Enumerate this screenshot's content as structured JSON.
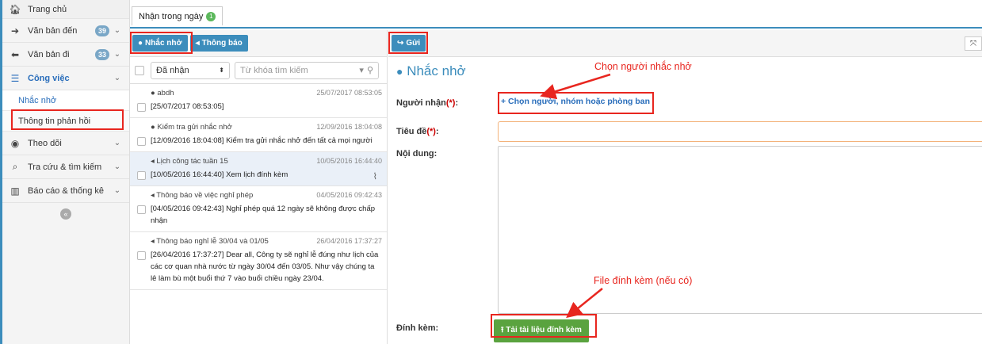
{
  "sidebar": {
    "home": "Trang chủ",
    "items": [
      {
        "label": "Văn bản đến",
        "badge": "39"
      },
      {
        "label": "Văn bản đi",
        "badge": "33"
      },
      {
        "label": "Công việc"
      }
    ],
    "sub_items": [
      "Nhắc nhở",
      "Thông tin phản hồi"
    ],
    "items2": [
      {
        "label": "Theo dõi"
      },
      {
        "label": "Tra cứu & tìm kiếm"
      },
      {
        "label": "Báo cáo & thống kê"
      }
    ]
  },
  "tab": {
    "label": "Nhận trong ngày",
    "count": "1"
  },
  "list_toolbar": {
    "reminder_button": "Nhắc nhở",
    "notice_button": "Thông báo"
  },
  "filter": {
    "selected": "Đã nhận",
    "search_placeholder": "Từ khóa tìm kiếm"
  },
  "messages": [
    {
      "title": "abdh",
      "date": "25/07/2017 08:53:05",
      "body": "[25/07/2017 08:53:05]"
    },
    {
      "title": "Kiểm tra gửi nhắc nhở",
      "date": "12/09/2016 18:04:08",
      "body": "[12/09/2016 18:04:08] Kiểm tra gửi nhắc nhở đến tất cả mọi người"
    },
    {
      "title": "Lịch công tác tuần 15",
      "date": "10/05/2016 16:44:40",
      "body": "[10/05/2016 16:44:40] Xem lịch đính kèm"
    },
    {
      "title": "Thông báo về việc nghỉ phép",
      "date": "04/05/2016 09:42:43",
      "body": "[04/05/2016 09:42:43] Nghỉ phép quá 12 ngày sẽ không được chấp nhận"
    },
    {
      "title": "Thông báo nghỉ lễ 30/04 và 01/05",
      "date": "26/04/2016 17:37:27",
      "body": "[26/04/2016 17:37:27] Dear all, Công ty sẽ nghỉ lễ đúng như lịch của các cơ quan nhà nước từ ngày 30/04 đến 03/05. Như vậy chúng ta lê làm bù một buổi thứ 7 vào buổi chiều ngày 23/04."
    }
  ],
  "form": {
    "send_button": "Gửi",
    "title": "Nhắc nhở",
    "recipient_label": "Người nhận",
    "recipient_link": "+ Chọn người, nhóm hoặc phòng ban",
    "subject_label": "Tiêu đề",
    "required_mark": "(*)",
    "content_label": "Nội dung:",
    "attach_label": "Đính kèm:",
    "attach_button": "Tải tài liệu đính kèm"
  },
  "annotations": {
    "choose_recipient": "Chọn người nhắc nhở",
    "attachment_note": "File đính kèm (nếu có)"
  },
  "colors": {
    "accent": "#3c8dbc",
    "annotation": "#e8261f",
    "success": "#5aa33f"
  }
}
